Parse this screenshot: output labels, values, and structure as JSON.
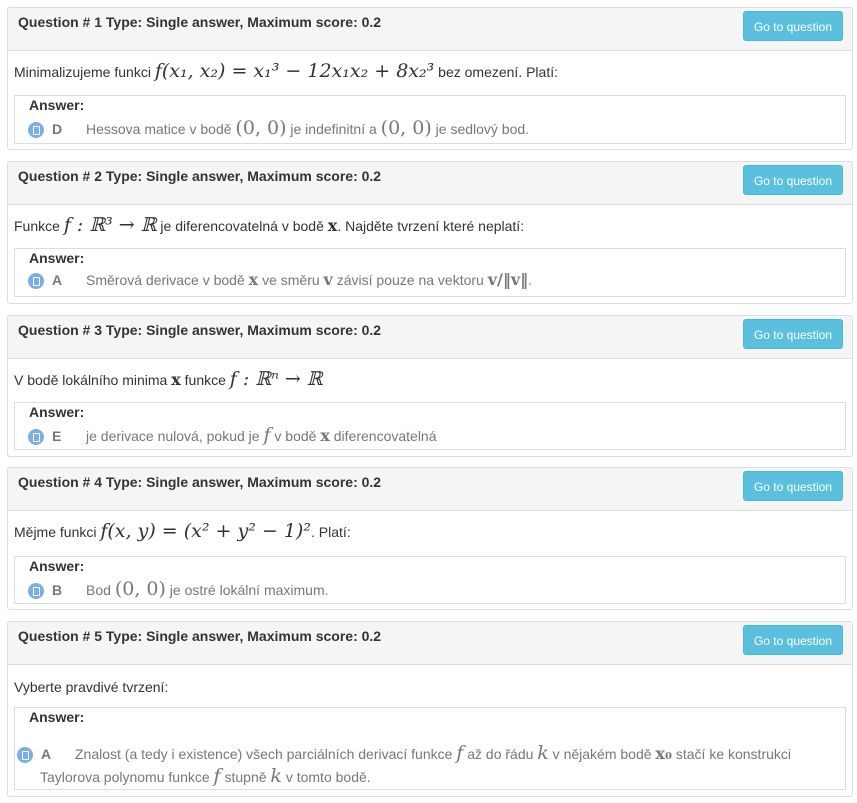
{
  "questions": [
    {
      "title": "Question # 1 Type: Single answer, Maximum score: 0.2",
      "goto": "Go to question",
      "text_before": "Minimalizujeme funkci ",
      "math": "f(x₁, x₂) = x₁³ − 12x₁x₂ + 8x₂³",
      "text_after": " bez omezení. Platí:",
      "answer_label": "Answer:",
      "letter": "D",
      "answer_parts": [
        "Hessova matice v bodě ",
        "(0, 0)",
        " je indefinitní a ",
        "(0, 0)",
        " je sedlový bod."
      ]
    },
    {
      "title": "Question # 2 Type: Single answer, Maximum score: 0.2",
      "goto": "Go to question",
      "text_before": "Funkce ",
      "math": "f : ℝ³ → ℝ",
      "text_mid": " je diferencovatelná v bodě ",
      "math2": "x",
      "text_after": ". Najděte tvrzení které neplatí:",
      "answer_label": "Answer:",
      "letter": "A",
      "answer_parts": [
        "Směrová derivace v bodě ",
        "x",
        " ve směru ",
        "v",
        " závisí pouze na vektoru ",
        "v/‖v‖",
        "."
      ]
    },
    {
      "title": "Question # 3 Type: Single answer, Maximum score: 0.2",
      "goto": "Go to question",
      "text_before": "V bodě lokálního minima ",
      "math": "x",
      "text_mid": " funkce ",
      "math2": "f : ℝⁿ → ℝ",
      "answer_label": "Answer:",
      "letter": "E",
      "answer_parts": [
        "je derivace nulová, pokud je ",
        "f",
        " v bodě ",
        "x",
        " diferencovatelná"
      ]
    },
    {
      "title": "Question # 4 Type: Single answer, Maximum score: 0.2",
      "goto": "Go to question",
      "text_before": "Mějme funkci ",
      "math": "f(x, y) = (x² + y² − 1)²",
      "text_after": ". Platí:",
      "answer_label": "Answer:",
      "letter": "B",
      "answer_parts": [
        "Bod ",
        "(0, 0)",
        " je ostré lokální maximum."
      ]
    },
    {
      "title": "Question # 5 Type: Single answer, Maximum score: 0.2",
      "goto": "Go to question",
      "text_before": "Vyberte pravdivé tvrzení:",
      "answer_label": "Answer:",
      "letter": "A",
      "answer_line1": [
        "Znalost (a tedy i existence) všech parciálních derivací funkce ",
        "f",
        " až do řádu ",
        "k",
        " v nějakém bodě ",
        "x₀",
        " stačí ke konstrukci"
      ],
      "answer_line2": [
        "Taylorova polynomu funkce ",
        "f",
        " stupně ",
        "k",
        " v tomto bodě."
      ]
    }
  ]
}
